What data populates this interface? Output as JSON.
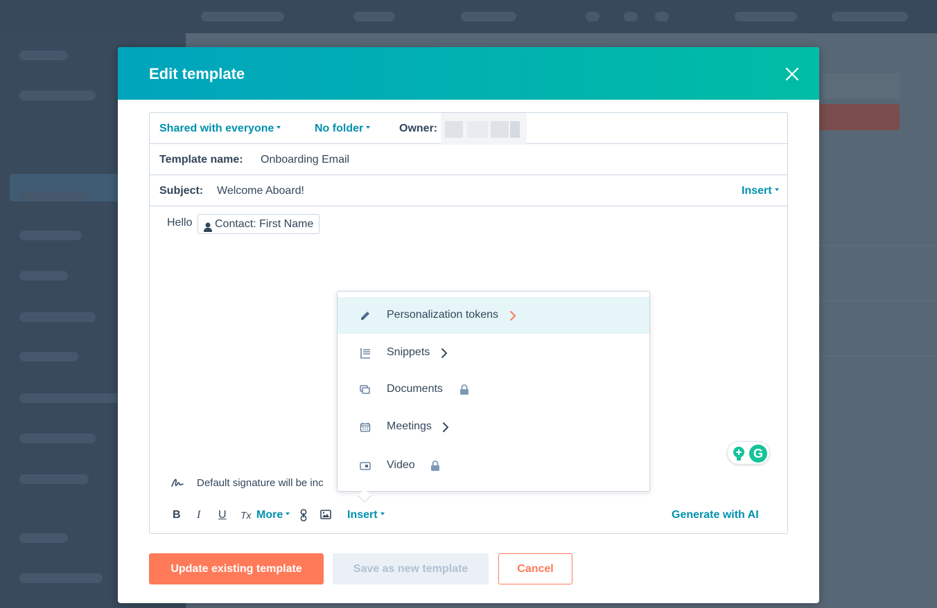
{
  "modal": {
    "title": "Edit template",
    "close_icon": "close-icon"
  },
  "meta_row": {
    "visibility": "Shared with everyone",
    "folder": "No folder",
    "owner_label": "Owner:"
  },
  "name_row": {
    "label": "Template name:",
    "value": "Onboarding Email"
  },
  "subject_row": {
    "label": "Subject:",
    "value": "Welcome Aboard!",
    "insert_label": "Insert"
  },
  "body": {
    "greeting": "Hello",
    "token": "Contact: First Name"
  },
  "insert_menu": {
    "items": [
      {
        "label": "Personalization tokens",
        "icon": "pencil-icon",
        "trailing": "chevron-right-icon",
        "highlighted": true
      },
      {
        "label": "Snippets",
        "icon": "snippet-icon",
        "trailing": "chevron-right-icon"
      },
      {
        "label": "Documents",
        "icon": "documents-icon",
        "trailing": "lock-icon"
      },
      {
        "label": "Meetings",
        "icon": "calendar-icon",
        "trailing": "chevron-right-icon"
      },
      {
        "label": "Video",
        "icon": "video-icon",
        "trailing": "lock-icon"
      }
    ]
  },
  "signature": {
    "text": "Default signature will be inc"
  },
  "toolbar": {
    "bold": "B",
    "italic": "I",
    "underline": "U",
    "clear_format": "Tx",
    "more_label": "More",
    "insert_label": "Insert",
    "ai_label": "Generate with AI"
  },
  "footer": {
    "update_label": "Update existing template",
    "save_new_label": "Save as new template",
    "cancel_label": "Cancel"
  },
  "colors": {
    "accent": "#0091ae",
    "primary": "#ff7a59",
    "header_gradient_start": "#00a4bd",
    "header_gradient_end": "#00bda5"
  }
}
